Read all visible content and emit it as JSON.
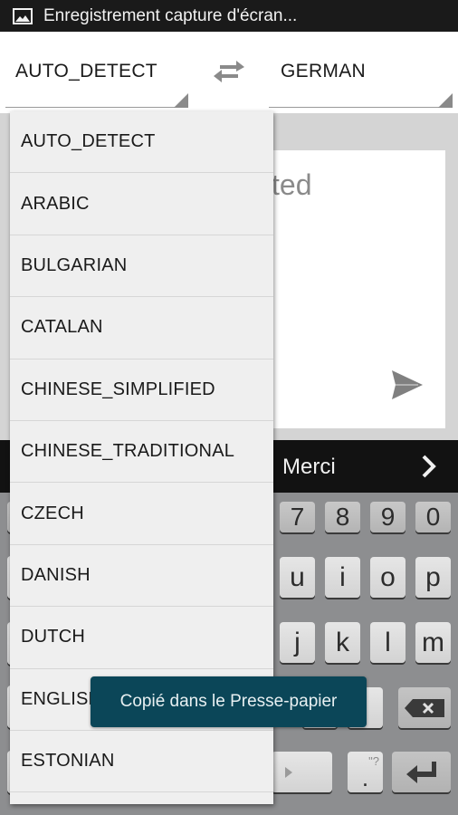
{
  "status_bar": {
    "icon": "image-icon",
    "title": "Enregistrement capture d'écran..."
  },
  "language_bar": {
    "source_language": "AUTO_DETECT",
    "target_language": "GERMAN",
    "swap_icon": "swap-arrows-icon"
  },
  "input": {
    "hint_visible": "ted",
    "send_icon": "send-icon"
  },
  "suggestion_bar": {
    "suggestion": "Merci",
    "next_icon": "chevron-right-icon"
  },
  "keyboard": {
    "number_row": [
      "7",
      "8",
      "9",
      "0"
    ],
    "row1": [
      "u",
      "i",
      "o",
      "p"
    ],
    "row2": [
      "j",
      "k",
      "l",
      "m"
    ],
    "backspace_icon": "backspace-icon",
    "period_key": ".",
    "period_alt": "\"?",
    "enter_icon": "enter-icon",
    "space_icon": "space-arrow-icon"
  },
  "dropdown": {
    "options": [
      "AUTO_DETECT",
      "ARABIC",
      "BULGARIAN",
      "CATALAN",
      "CHINESE_SIMPLIFIED",
      "CHINESE_TRADITIONAL",
      "CZECH",
      "DANISH",
      "DUTCH",
      "ENGLISH",
      "ESTONIAN"
    ]
  },
  "toast": {
    "message": "Copié dans le Presse-papier"
  },
  "colors": {
    "toast_bg": "#0b4658",
    "status_bar_bg": "#1a1a1a",
    "keyboard_bg": "#8d8e90"
  }
}
